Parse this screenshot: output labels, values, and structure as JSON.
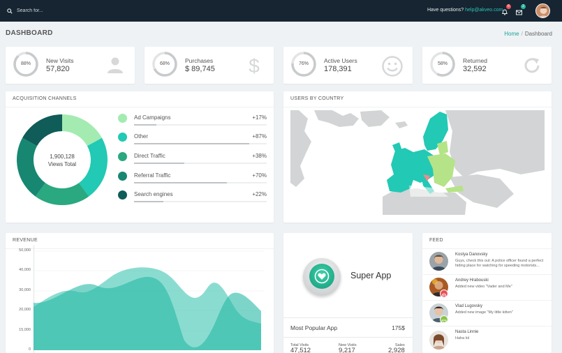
{
  "topbar": {
    "search_placeholder": "Search for...",
    "questions_label": "Have questions?",
    "support_email": "help@akveo.com",
    "notifications_count": "6",
    "messages_count": "2"
  },
  "header": {
    "title": "DASHBOARD"
  },
  "breadcrumb": {
    "home": "Home",
    "current": "Dashboard"
  },
  "stats": [
    {
      "percent": "88%",
      "label": "New Visits",
      "value": "57,820",
      "icon": "person-icon",
      "fraction": 0.88
    },
    {
      "percent": "68%",
      "label": "Purchases",
      "value": "$ 89,745",
      "icon": "dollar-icon",
      "fraction": 0.68
    },
    {
      "percent": "76%",
      "label": "Active Users",
      "value": "178,391",
      "icon": "smiley-icon",
      "fraction": 0.76
    },
    {
      "percent": "58%",
      "label": "Returned",
      "value": "32,592",
      "icon": "refresh-icon",
      "fraction": 0.58
    }
  ],
  "acquisition": {
    "title": "ACQUISITION CHANNELS",
    "total_value": "1,900,128",
    "total_label": "Views Total",
    "channels": [
      {
        "name": "Ad Campaigns",
        "change": "+17%",
        "color": "#a3ebb1",
        "share": 17,
        "bar": 0.17
      },
      {
        "name": "Other",
        "change": "+87%",
        "color": "#22c9b4",
        "share": 23,
        "bar": 0.87
      },
      {
        "name": "Direct Traffic",
        "change": "+38%",
        "color": "#2aa87f",
        "share": 20,
        "bar": 0.38
      },
      {
        "name": "Referral Traffic",
        "change": "+70%",
        "color": "#178771",
        "share": 23,
        "bar": 0.7
      },
      {
        "name": "Search engines",
        "change": "+22%",
        "color": "#0f5c59",
        "share": 17,
        "bar": 0.22
      }
    ]
  },
  "users_by_country": {
    "title": "USERS BY COUNTRY"
  },
  "revenue": {
    "title": "REVENUE",
    "y_ticks": [
      "50,000",
      "40,000",
      "30,000",
      "20,000",
      "15,000",
      "0"
    ]
  },
  "app": {
    "name": "Super App",
    "most_popular_label": "Most Popular App",
    "most_popular_value": "175$",
    "bottom_stats": [
      {
        "label": "Total Visits",
        "value": "47,512"
      },
      {
        "label": "New Visits",
        "value": "9,217"
      },
      {
        "label": "Sales",
        "value": "2,928"
      }
    ]
  },
  "feed": {
    "title": "FEED",
    "items": [
      {
        "name": "Kostya Danovsky",
        "text": "Guys, check this out: A police officer found a perfect hiding place for watching for speeding motorists..."
      },
      {
        "name": "Andrey Hrabouski",
        "text": "Added new video \"Vader and Me\""
      },
      {
        "name": "Vlad Lugovsky",
        "text": "Added new image \"My little kitten\""
      },
      {
        "name": "Nasta Linnie",
        "text": "Haha lol"
      }
    ]
  },
  "colors": {
    "accent": "#1aa39a",
    "topbar": "#162531",
    "map_highlight": "#22c9b4",
    "revenue_fill": "#26b9a6"
  }
}
